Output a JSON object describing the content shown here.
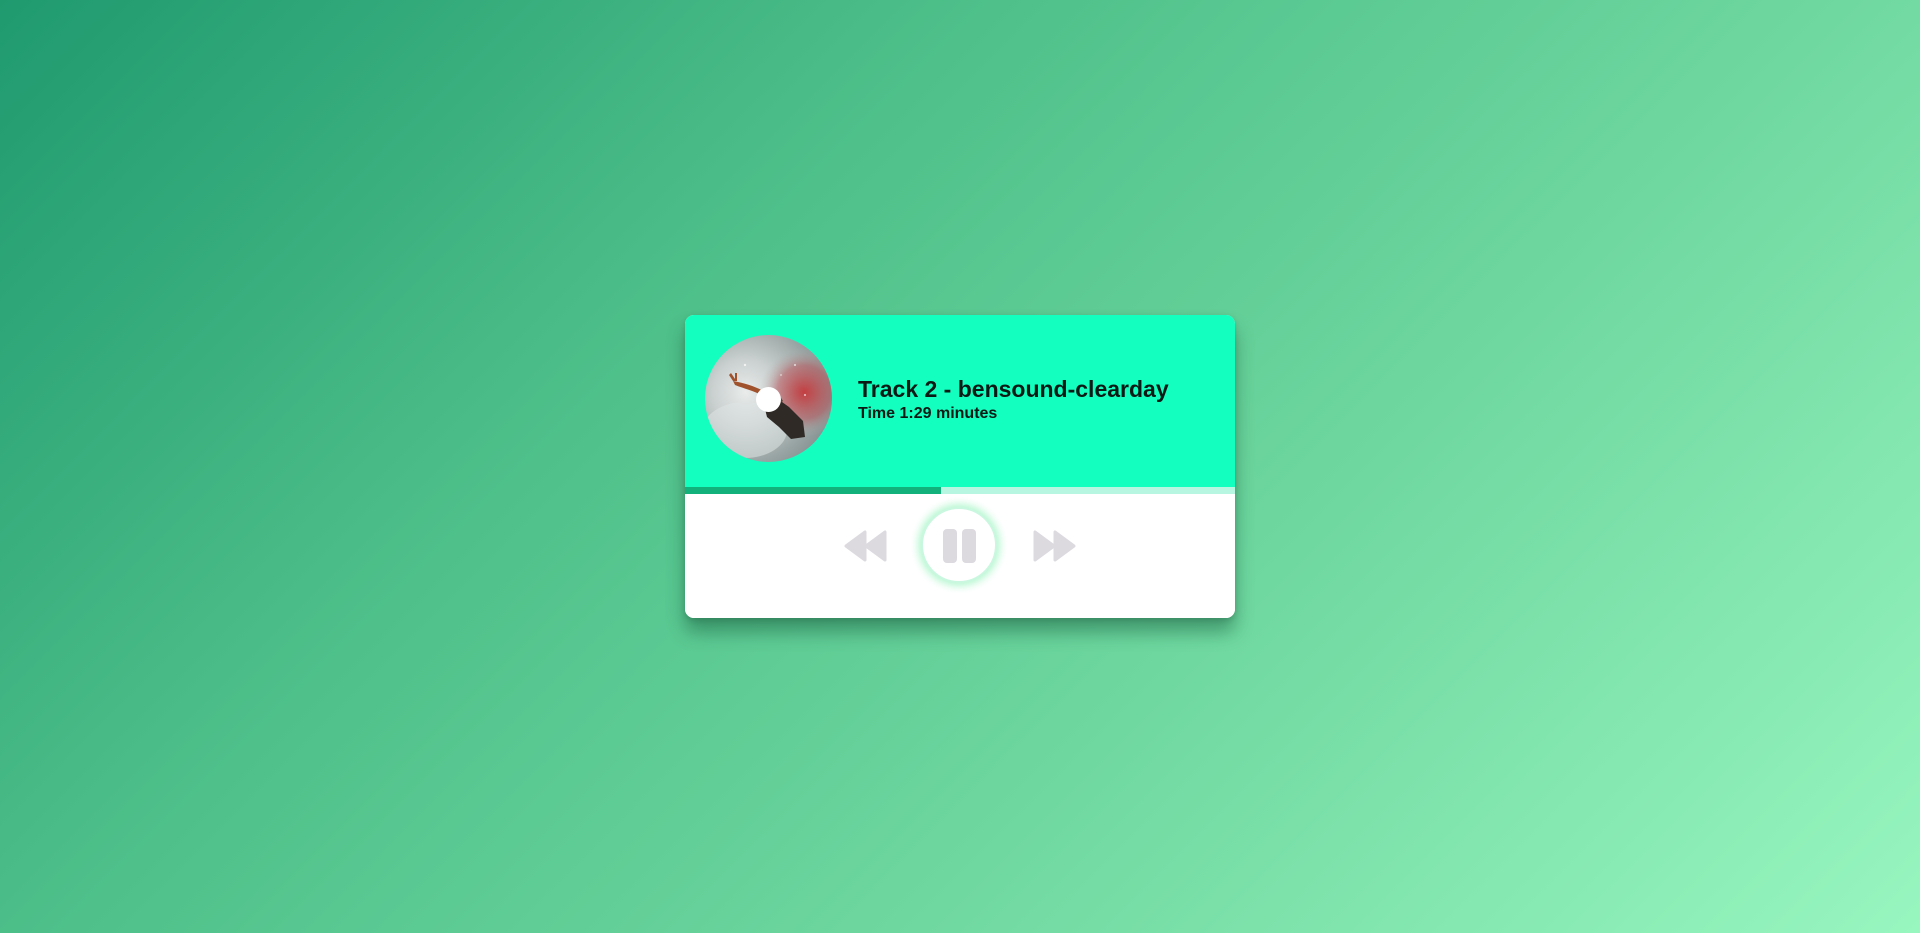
{
  "track": {
    "title": "Track 2 - bensound-clearday",
    "time_text": "Time 1:29 minutes"
  },
  "progress": {
    "fraction": 0.465
  },
  "controls": {
    "rewind_icon": "rewind-icon",
    "pause_icon": "pause-icon",
    "forward_icon": "fast-forward-icon"
  },
  "colors": {
    "header": "#12ffc0",
    "progress_fill": "#12b07a",
    "progress_track": "#b7f7e2",
    "icon": "#dcd9df",
    "glow": "#78f0aa"
  }
}
